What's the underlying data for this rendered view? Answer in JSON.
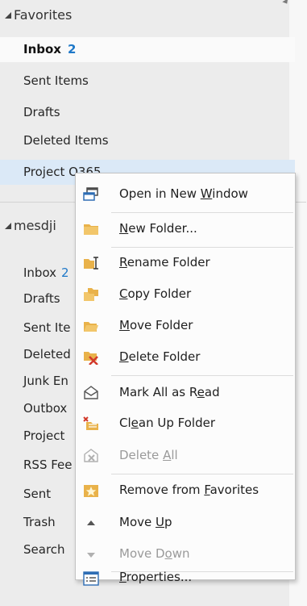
{
  "favorites": {
    "header": "Favorites",
    "items": [
      {
        "label": "Inbox",
        "count": "2"
      },
      {
        "label": "Sent Items"
      },
      {
        "label": "Drafts"
      },
      {
        "label": "Deleted Items"
      },
      {
        "label": "Project O365"
      }
    ]
  },
  "account": {
    "header": "mesdji",
    "items": [
      {
        "label": "Inbox",
        "count": "2"
      },
      {
        "label": "Drafts"
      },
      {
        "label": "Sent Ite"
      },
      {
        "label": "Deleted"
      },
      {
        "label": "Junk En"
      },
      {
        "label": "Outbox"
      },
      {
        "label": "Project"
      },
      {
        "label": "RSS Fee"
      },
      {
        "label": "Sent"
      },
      {
        "label": "Trash"
      },
      {
        "label": "Search"
      }
    ]
  },
  "context_menu": {
    "items": [
      {
        "icon": "open-window-icon",
        "pre": "Open in New ",
        "key": "W",
        "post": "indow",
        "enabled": true
      },
      {
        "icon": "new-folder-icon",
        "pre": "",
        "key": "N",
        "post": "ew Folder...",
        "enabled": true
      },
      {
        "icon": "rename-folder-icon",
        "pre": "",
        "key": "R",
        "post": "ename Folder",
        "enabled": true
      },
      {
        "icon": "copy-folder-icon",
        "pre": "",
        "key": "C",
        "post": "opy Folder",
        "enabled": true
      },
      {
        "icon": "move-folder-icon",
        "pre": "",
        "key": "M",
        "post": "ove Folder",
        "enabled": true
      },
      {
        "icon": "delete-folder-icon",
        "pre": "",
        "key": "D",
        "post": "elete Folder",
        "enabled": true
      },
      {
        "icon": "mark-read-icon",
        "pre": "Mark All as R",
        "key": "e",
        "post": "ad",
        "enabled": true
      },
      {
        "icon": "clean-up-icon",
        "pre": "Cl",
        "key": "e",
        "post": "an Up Folder",
        "enabled": true
      },
      {
        "icon": "delete-all-icon",
        "pre": "Delete ",
        "key": "A",
        "post": "ll",
        "enabled": false
      },
      {
        "icon": "remove-favorites-icon",
        "pre": "Remove from ",
        "key": "F",
        "post": "avorites",
        "enabled": true
      },
      {
        "icon": "move-up-icon",
        "pre": "Move ",
        "key": "U",
        "post": "p",
        "enabled": true
      },
      {
        "icon": "move-down-icon",
        "pre": "Move D",
        "key": "o",
        "post": "wn",
        "enabled": false
      },
      {
        "icon": "properties-icon",
        "pre": "",
        "key": "P",
        "post": "roperties...",
        "enabled": true
      }
    ]
  },
  "colors": {
    "accent": "#1e78c8",
    "hover_row": "#dbe9f7",
    "pane_bg": "#ececec",
    "folder_yellow": "#e9b24a",
    "delete_red": "#d23a2b"
  }
}
